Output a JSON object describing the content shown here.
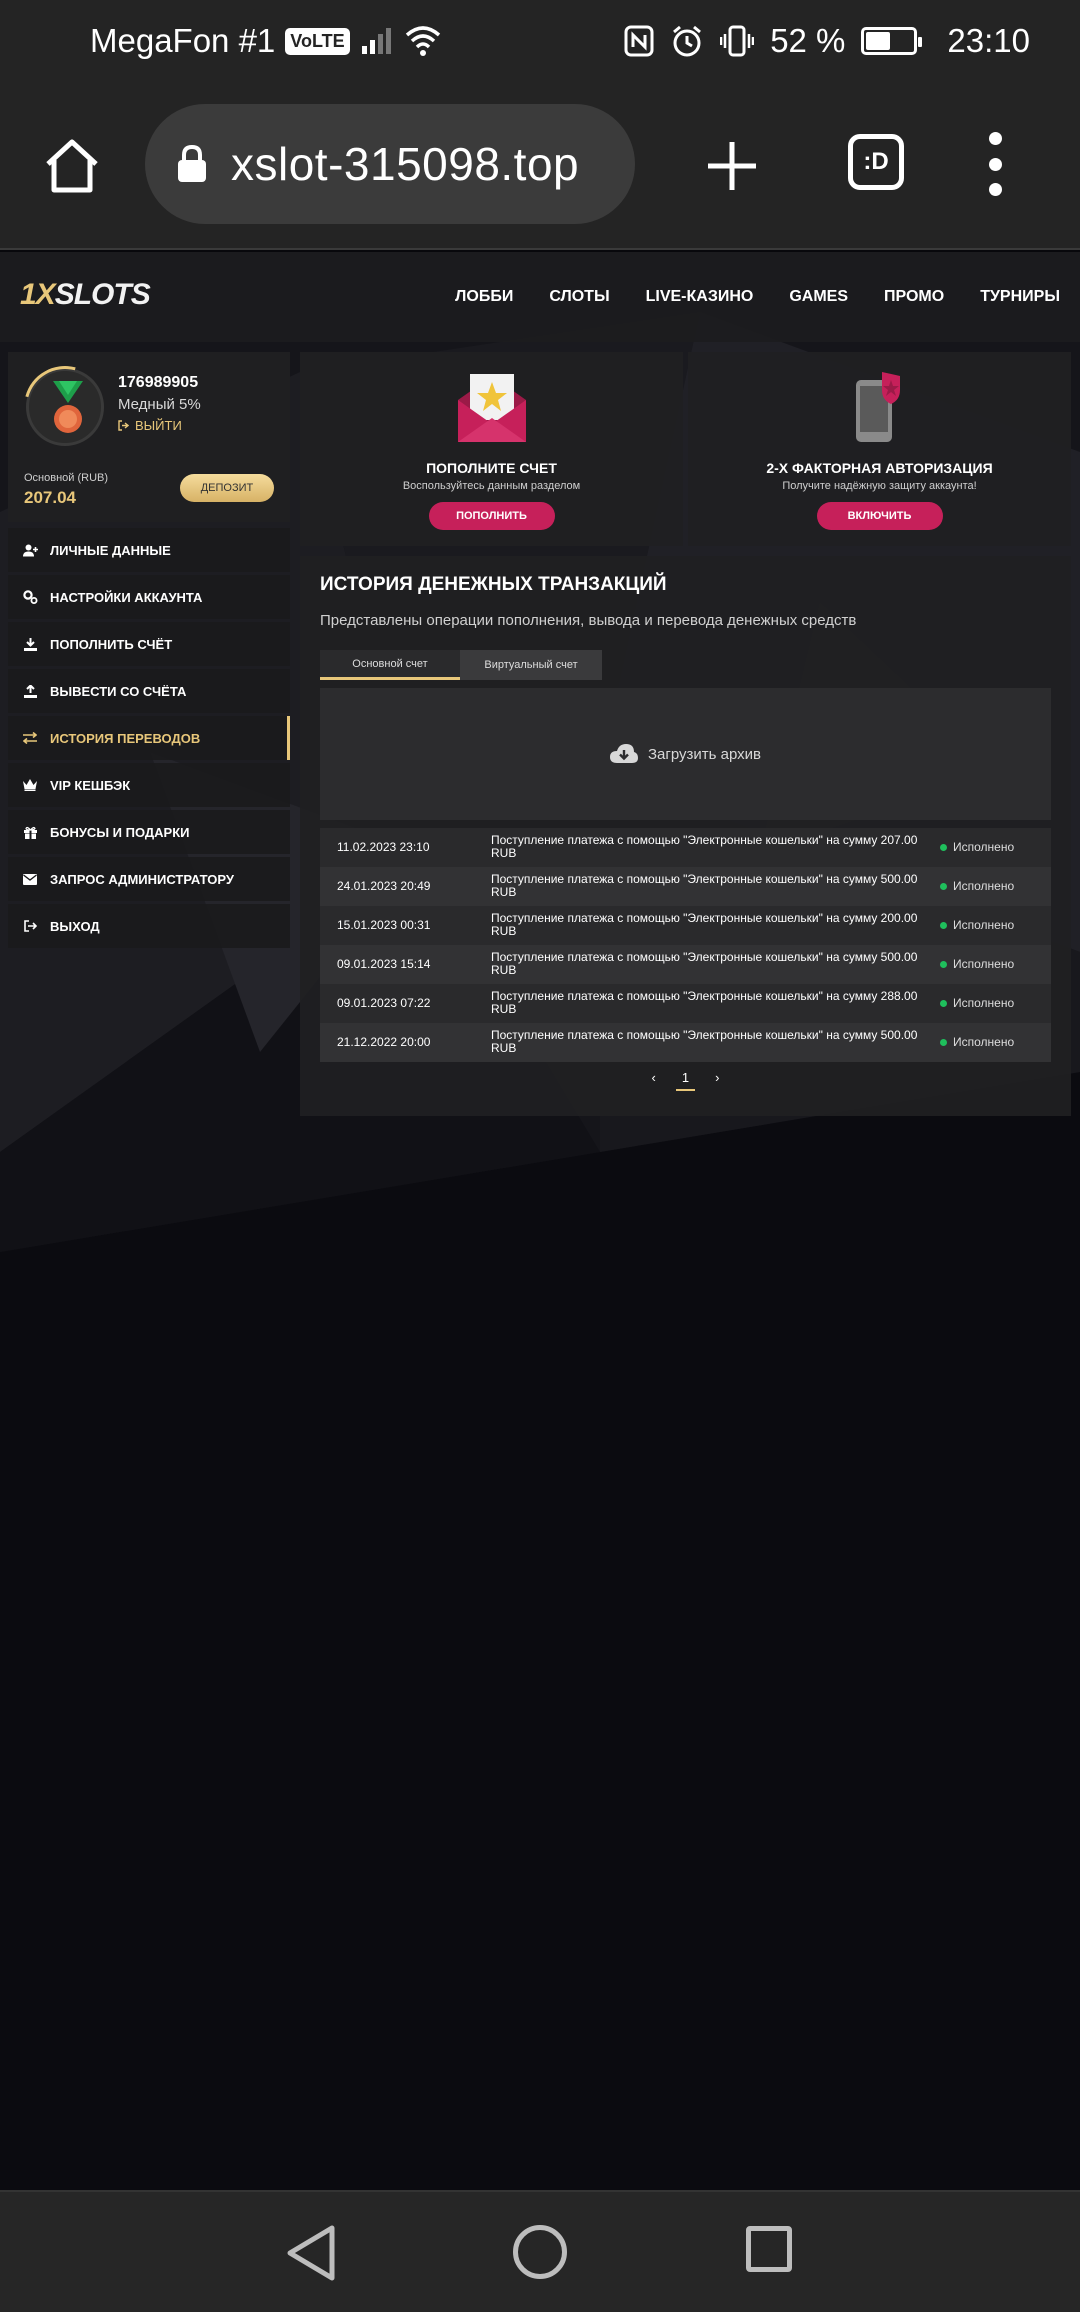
{
  "status_bar": {
    "carrier": "MegaFon #1",
    "volte": "VoLTE",
    "battery_text": "52 %",
    "battery_level": 0.52,
    "time": "23:10"
  },
  "browser": {
    "url": "xslot-315098.top",
    "tabs_icon_text": ":D"
  },
  "site": {
    "logo_prefix": "1X",
    "logo_suffix": "SLOTS",
    "nav": [
      "ЛОББИ",
      "СЛОТЫ",
      "LIVE-КАЗИНО",
      "GAMES",
      "ПРОМО",
      "ТУРНИРЫ"
    ]
  },
  "profile": {
    "user_id": "176989905",
    "level": "Медный 5%",
    "logout": "ВЫЙТИ",
    "balance_label": "Основной (RUB)",
    "balance_value": "207.04",
    "deposit_button": "ДЕПОЗИТ"
  },
  "sidebar_menu": [
    {
      "label": "ЛИЧНЫЕ ДАННЫЕ",
      "icon": "user-plus-icon",
      "active": false
    },
    {
      "label": "НАСТРОЙКИ АККАУНТА",
      "icon": "gears-icon",
      "active": false
    },
    {
      "label": "ПОПОЛНИТЬ СЧЁТ",
      "icon": "download-icon",
      "active": false
    },
    {
      "label": "ВЫВЕСТИ СО СЧЁТА",
      "icon": "upload-icon",
      "active": false
    },
    {
      "label": "ИСТОРИЯ ПЕРЕВОДОВ",
      "icon": "transfer-icon",
      "active": true
    },
    {
      "label": "VIP КЕШБЭК",
      "icon": "crown-icon",
      "active": false
    },
    {
      "label": "БОНУСЫ И ПОДАРКИ",
      "icon": "gift-icon",
      "active": false
    },
    {
      "label": "ЗАПРОС АДМИНИСТРАТОРУ",
      "icon": "envelope-icon",
      "active": false
    },
    {
      "label": "ВЫХОД",
      "icon": "logout-icon",
      "active": false
    }
  ],
  "promo_cards": [
    {
      "title": "ПОПОЛНИТЕ СЧЕТ",
      "subtitle": "Воспользуйтесь данным разделом",
      "button": "ПОПОЛНИТЬ",
      "icon": "envelope-star-icon"
    },
    {
      "title": "2-Х ФАКТОРНАЯ АВТОРИЗАЦИЯ",
      "subtitle": "Получите надёжную защиту аккаунта!",
      "button": "ВКЛЮЧИТЬ",
      "icon": "phone-shield-icon"
    }
  ],
  "history": {
    "title": "ИСТОРИЯ ДЕНЕЖНЫХ ТРАНЗАКЦИЙ",
    "description": "Представлены операции пополнения, вывода и перевода денежных средств",
    "tabs": [
      "Основной счет",
      "Виртуальный счет"
    ],
    "archive": "Загрузить архив",
    "rows": [
      {
        "date": "11.02.2023 23:10",
        "desc": "Поступление платежа с помощью \"Электронные кошельки\" на сумму 207.00 RUB",
        "status": "Исполнено"
      },
      {
        "date": "24.01.2023 20:49",
        "desc": "Поступление платежа с помощью \"Электронные кошельки\" на сумму 500.00 RUB",
        "status": "Исполнено"
      },
      {
        "date": "15.01.2023 00:31",
        "desc": "Поступление платежа с помощью \"Электронные кошельки\" на сумму 200.00 RUB",
        "status": "Исполнено"
      },
      {
        "date": "09.01.2023 15:14",
        "desc": "Поступление платежа с помощью \"Электронные кошельки\" на сумму 500.00 RUB",
        "status": "Исполнено"
      },
      {
        "date": "09.01.2023 07:22",
        "desc": "Поступление платежа с помощью \"Электронные кошельки\" на сумму 288.00 RUB",
        "status": "Исполнено"
      },
      {
        "date": "21.12.2022 20:00",
        "desc": "Поступление платежа с помощью \"Электронные кошельки\" на сумму 500.00 RUB",
        "status": "Исполнено"
      }
    ],
    "pager": {
      "prev": "‹",
      "page": "1",
      "next": "›"
    }
  },
  "colors": {
    "accent_gold": "#e8c77a",
    "accent_pink": "#c6205a",
    "status_green": "#1fbf5c"
  }
}
